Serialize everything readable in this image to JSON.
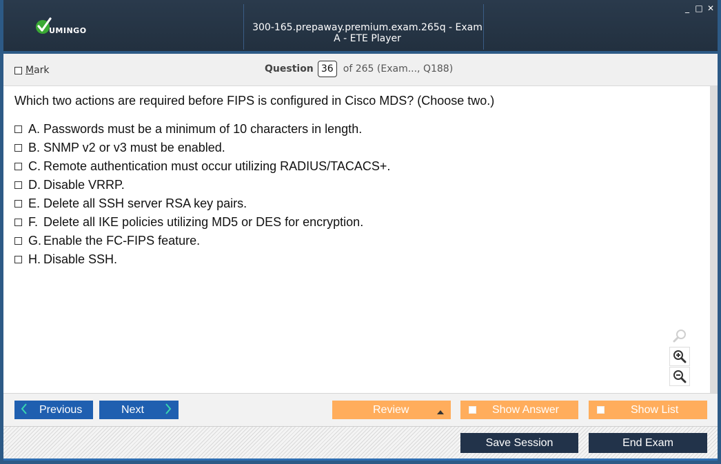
{
  "window": {
    "title": "300-165.prepaway.premium.exam.265q - Exam A - ETE Player",
    "logo_text": "UMINGO",
    "minimize_glyph": "_",
    "maximize_glyph": "□",
    "close_glyph": "✕"
  },
  "header": {
    "mark_label_prefix": "M",
    "mark_label_rest": "ark",
    "question_word": "Question",
    "question_number": "36",
    "question_of": "of 265 (Exam..., Q188)"
  },
  "question": {
    "text": "Which two actions are required before FIPS is configured in Cisco MDS? (Choose two.)",
    "options": [
      {
        "letter": "A.",
        "text": "Passwords must be a minimum of 10 characters in length."
      },
      {
        "letter": "B.",
        "text": "SNMP v2 or v3 must be enabled."
      },
      {
        "letter": "C.",
        "text": "Remote authentication must occur utilizing RADIUS/TACACS+."
      },
      {
        "letter": "D.",
        "text": "Disable VRRP."
      },
      {
        "letter": "E.",
        "text": "Delete all SSH server RSA key pairs."
      },
      {
        "letter": "F.",
        "text": "Delete all IKE policies utilizing MD5 or DES for encryption."
      },
      {
        "letter": "G.",
        "text": "Enable the FC-FIPS feature."
      },
      {
        "letter": "H.",
        "text": "Disable SSH."
      }
    ]
  },
  "zoom": {
    "icons": [
      "magnifier-icon",
      "zoom-in-icon",
      "zoom-out-icon"
    ]
  },
  "nav": {
    "previous_label": "Previous",
    "next_label": "Next",
    "review_label": "Review",
    "show_answer_label": "Show Answer",
    "show_list_label": "Show List"
  },
  "footer": {
    "save_session_label": "Save Session",
    "end_exam_label": "End Exam"
  },
  "colors": {
    "titlebar": "#22303f",
    "nav_blue": "#1f5fb0",
    "orange": "#ffad5c",
    "dark_button": "#22334a"
  }
}
